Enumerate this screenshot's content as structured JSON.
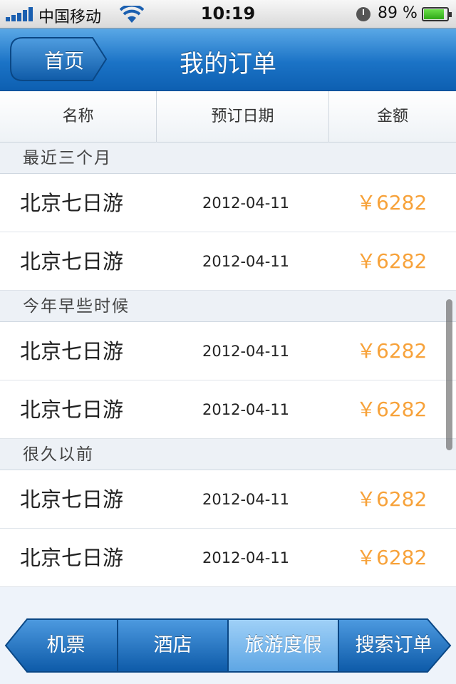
{
  "status_bar": {
    "carrier": "中国移动",
    "time": "10:19",
    "battery": "89 %",
    "battery_level": 0.89,
    "icons": [
      "signal-icon",
      "wifi-icon",
      "clock-icon",
      "battery-icon"
    ]
  },
  "nav": {
    "back_label": "首页",
    "title": "我的订单"
  },
  "columns": [
    "名称",
    "预订日期",
    "金额"
  ],
  "sections": [
    {
      "title": "最近三个月",
      "rows": [
        {
          "name": "北京七日游",
          "date": "2012-04-11",
          "price": "￥6282"
        },
        {
          "name": "北京七日游",
          "date": "2012-04-11",
          "price": "￥6282"
        }
      ]
    },
    {
      "title": "今年早些时候",
      "rows": [
        {
          "name": "北京七日游",
          "date": "2012-04-11",
          "price": "￥6282"
        },
        {
          "name": "北京七日游",
          "date": "2012-04-11",
          "price": "￥6282"
        }
      ]
    },
    {
      "title": "很久以前",
      "rows": [
        {
          "name": "北京七日游",
          "date": "2012-04-11",
          "price": "￥6282"
        },
        {
          "name": "北京七日游",
          "date": "2012-04-11",
          "price": "￥6282"
        }
      ]
    }
  ],
  "tabs": [
    {
      "label": "机票",
      "selected": false
    },
    {
      "label": "酒店",
      "selected": false
    },
    {
      "label": "旅游度假",
      "selected": true
    },
    {
      "label": "搜索订单",
      "selected": false
    }
  ],
  "colors": {
    "nav_blue": "#1b73c6",
    "price_orange": "#f7a23a",
    "tab_selected": "#6fb3ec"
  }
}
